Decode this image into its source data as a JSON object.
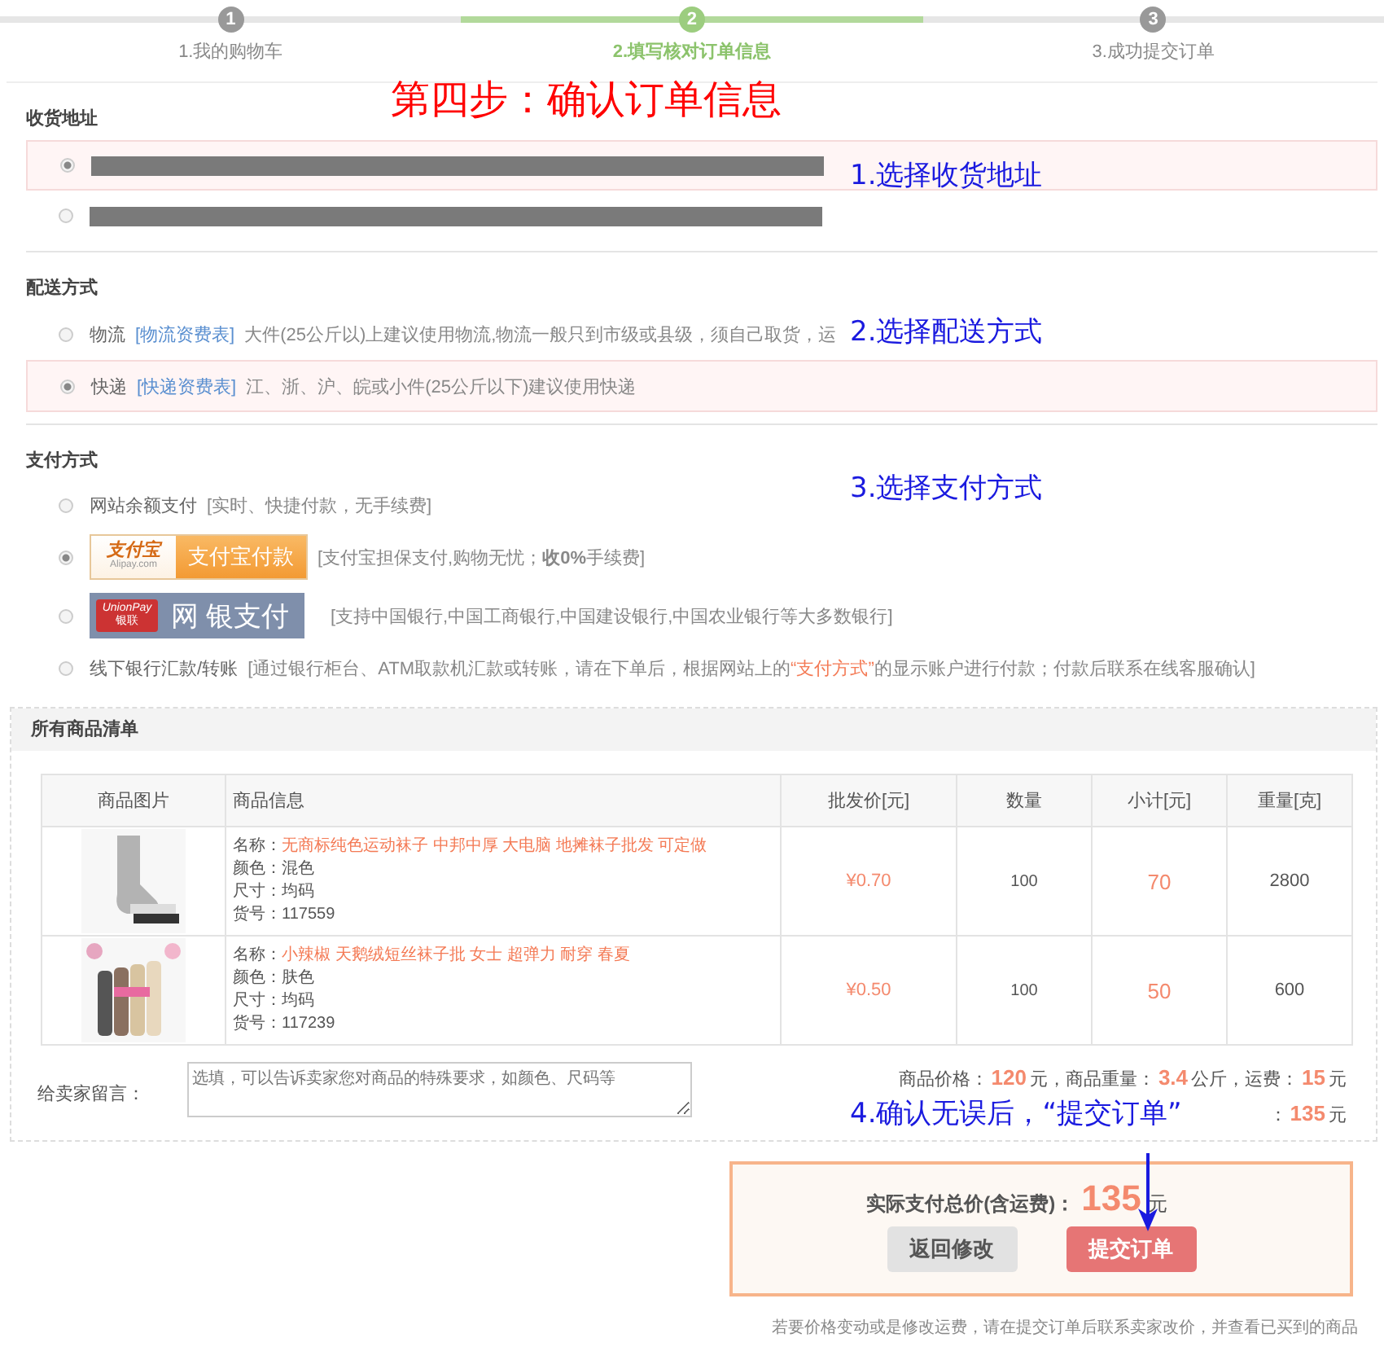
{
  "steps": [
    {
      "number": "1",
      "label": "1.我的购物车",
      "selected": false
    },
    {
      "number": "2",
      "label": "2.填写核对订单信息",
      "selected": true
    },
    {
      "number": "3",
      "label": "3.成功提交订单",
      "selected": false
    }
  ],
  "overlay_title": "第四步：确认订单信息",
  "annotations": [
    "1.选择收货地址",
    "2.选择配送方式",
    "3.选择支付方式",
    "4.确认无误后，“提交订单”"
  ],
  "address": {
    "title": "收货地址",
    "options": [
      {
        "selected": true
      },
      {
        "selected": false
      }
    ]
  },
  "delivery": {
    "title": "配送方式",
    "options": [
      {
        "name": "物流",
        "link": "[物流资费表]",
        "note": "大件(25公斤以)上建议使用物流,物流一般只到市级或县级，须自己取货，运",
        "selected": false
      },
      {
        "name": "快递",
        "link": "[快递资费表]",
        "note": "江、浙、沪、皖或小件(25公斤以下)建议使用快递",
        "selected": true
      }
    ]
  },
  "payment": {
    "title": "支付方式",
    "options": [
      {
        "kind": "text",
        "label": "网站余额支付",
        "note": "[实时、快捷付款，无手续费]",
        "selected": false
      },
      {
        "kind": "alipay",
        "logo": "支付宝",
        "logo_sub": "Alipay.com",
        "label": "支付宝付款",
        "note": "[支付宝担保支付,购物无忧；**收0%**手续费]",
        "selected": true
      },
      {
        "kind": "unionpay",
        "logo": "UnionPay",
        "logo_sub": "银联",
        "label": "网 银支付",
        "note": "[支持中国银行,中国工商银行,中国建设银行,中国农业银行等大多数银行]",
        "selected": false
      },
      {
        "kind": "text",
        "label": "线下银行汇款/转账",
        "note": "[通过银行柜台、ATM取款机汇款或转账，请在下单后，根据网站上的",
        "highlight": "“支付方式”",
        "note_after": "的显示账户进行付款；付款后联系在线客服确认]",
        "selected": false
      }
    ]
  },
  "goods": {
    "title": "所有商品清单",
    "columns": [
      "商品图片",
      "商品信息",
      "批发价[元]",
      "数量",
      "小计[元]",
      "重量[克]"
    ],
    "rows": [
      {
        "info": [
          {
            "label": "名称：",
            "value": "无商标纯色运动袜子 中邦中厚 大电脑 地摊袜子批发 可定做",
            "highlight": true
          },
          {
            "label": "颜色：",
            "value": "混色",
            "highlight": false
          },
          {
            "label": "尺寸：",
            "value": "均码",
            "highlight": false
          },
          {
            "label": "货号：",
            "value": "117559",
            "highlight": false
          }
        ],
        "price": "¥0.70",
        "quantity": "100",
        "subtotal": "70",
        "weight": "2800"
      },
      {
        "info": [
          {
            "label": "名称：",
            "value": "小辣椒 天鹅绒短丝袜子批 女士 超弹力 耐穿 春夏",
            "highlight": true
          },
          {
            "label": "颜色：",
            "value": "肤色",
            "highlight": false
          },
          {
            "label": "尺寸：",
            "value": "均码",
            "highlight": false
          },
          {
            "label": "货号：",
            "value": "117239",
            "highlight": false
          }
        ],
        "price": "¥0.50",
        "quantity": "100",
        "subtotal": "50",
        "weight": "600"
      }
    ],
    "message": {
      "label": "给卖家留言：",
      "placeholder": "选填，可以告诉卖家您对商品的特殊要求，如颜色、尺码等"
    },
    "summary": [
      {
        "text": "商品价格：",
        "emphasis": false
      },
      {
        "text": "120",
        "emphasis": true
      },
      {
        "text": "元，商品重量：",
        "emphasis": false
      },
      {
        "text": "3.4",
        "emphasis": true
      },
      {
        "text": "公斤，运费：",
        "emphasis": false
      },
      {
        "text": "15",
        "emphasis": true
      },
      {
        "text": "元",
        "emphasis": false
      }
    ],
    "total": [
      {
        "text": "：",
        "emphasis": false
      },
      {
        "text": "135",
        "emphasis": true
      },
      {
        "text": "元",
        "emphasis": false
      }
    ]
  },
  "pay_box": {
    "label": "实际支付总价(含运费)：",
    "amount": "135",
    "unit": "元",
    "buttons": [
      {
        "kind": "back",
        "label": "返回修改"
      },
      {
        "kind": "submit",
        "label": "提交订单"
      }
    ]
  },
  "footer_note": "若要价格变动或是修改运费，请在提交订单后联系卖家改价，并查看已买到的商品"
}
